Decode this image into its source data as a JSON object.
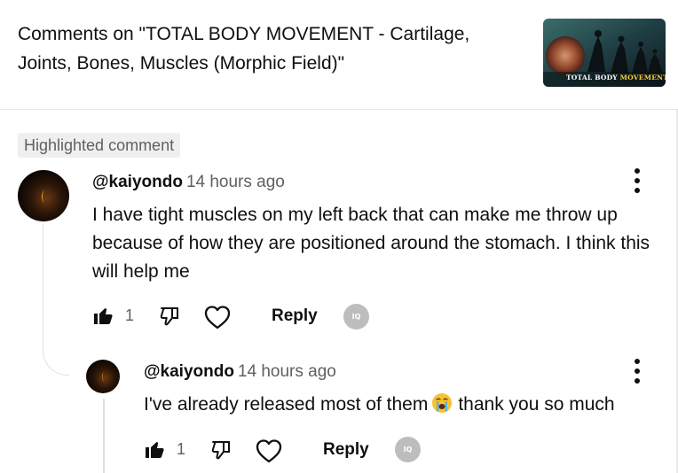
{
  "header": {
    "title": "Comments on \"TOTAL BODY MOVEMENT - Cartilage, Joints, Bones, Muscles (Morphic Field)\"",
    "thumbnail": {
      "caption_part1": "TOTAL BODY ",
      "caption_part2": "MOVEMENT"
    }
  },
  "highlighted_label": "Highlighted comment",
  "comment": {
    "author": "@kaiyondo",
    "time": "14 hours ago",
    "text": "I have tight muscles on my left back that can make me throw up because of how they are positioned around the stomach. I think this will help me",
    "like_count": "1",
    "reply_label": "Reply",
    "badge_label": "IQ"
  },
  "reply": {
    "author": "@kaiyondo",
    "time": "14 hours ago",
    "text_before": "I've already released most of them",
    "emoji": "loudly-crying-face",
    "text_after": "thank you so much",
    "like_count": "1",
    "reply_label": "Reply",
    "badge_label": "IQ"
  },
  "colors": {
    "text": "#0f0f0f",
    "secondary": "#606060",
    "badge_bg": "#efefef",
    "divider": "#e5e5e5"
  }
}
